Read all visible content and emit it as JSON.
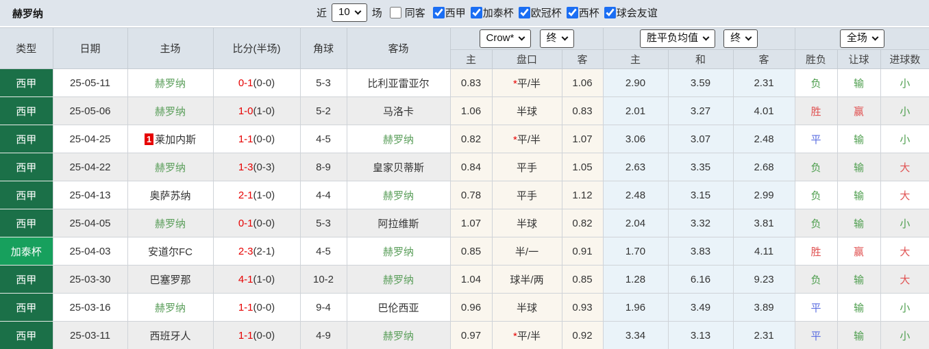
{
  "topbar": {
    "team_title": "赫罗纳",
    "recent_label": "近",
    "recent_count": "10",
    "matches_label": "场",
    "filters": [
      {
        "label": "同客",
        "checked": false
      },
      {
        "label": "西甲",
        "checked": true
      },
      {
        "label": "加泰杯",
        "checked": true
      },
      {
        "label": "欧冠杯",
        "checked": true
      },
      {
        "label": "西杯",
        "checked": true
      },
      {
        "label": "球会友谊",
        "checked": true
      }
    ]
  },
  "table": {
    "main_headers": [
      "类型",
      "日期",
      "主场",
      "比分(半场)",
      "角球",
      "客场"
    ],
    "selectors": {
      "odds_company": "Crow*",
      "odds_stage": "终",
      "avg_company": "胜平负均值",
      "avg_stage": "终",
      "scope": "全场"
    },
    "sub_headers": [
      "主",
      "盘口",
      "客",
      "主",
      "和",
      "客",
      "胜负",
      "让球",
      "进球数"
    ],
    "rows": [
      {
        "type": "西甲",
        "date": "25-05-11",
        "home": "赫罗纳",
        "home_badge": "",
        "score": "0-1",
        "half": "(0-0)",
        "corner": "5-3",
        "away": "比利亚雷亚尔",
        "odds_home": "0.83",
        "handicap_star": "*",
        "handicap": "平/半",
        "odds_away": "1.06",
        "avg_home": "2.90",
        "avg_draw": "3.59",
        "avg_away": "2.31",
        "result": "负",
        "handicap_result": "输",
        "goals": "小"
      },
      {
        "type": "西甲",
        "date": "25-05-06",
        "home": "赫罗纳",
        "home_badge": "",
        "score": "1-0",
        "half": "(1-0)",
        "corner": "5-2",
        "away": "马洛卡",
        "odds_home": "1.06",
        "handicap_star": "",
        "handicap": "半球",
        "odds_away": "0.83",
        "avg_home": "2.01",
        "avg_draw": "3.27",
        "avg_away": "4.01",
        "result": "胜",
        "handicap_result": "赢",
        "goals": "小"
      },
      {
        "type": "西甲",
        "date": "25-04-25",
        "home": "莱加内斯",
        "home_badge": "1",
        "score": "1-1",
        "half": "(0-0)",
        "corner": "4-5",
        "away": "赫罗纳",
        "odds_home": "0.82",
        "handicap_star": "*",
        "handicap": "平/半",
        "odds_away": "1.07",
        "avg_home": "3.06",
        "avg_draw": "3.07",
        "avg_away": "2.48",
        "result": "平",
        "handicap_result": "输",
        "goals": "小"
      },
      {
        "type": "西甲",
        "date": "25-04-22",
        "home": "赫罗纳",
        "home_badge": "",
        "score": "1-3",
        "half": "(0-3)",
        "corner": "8-9",
        "away": "皇家贝蒂斯",
        "odds_home": "0.84",
        "handicap_star": "",
        "handicap": "平手",
        "odds_away": "1.05",
        "avg_home": "2.63",
        "avg_draw": "3.35",
        "avg_away": "2.68",
        "result": "负",
        "handicap_result": "输",
        "goals": "大"
      },
      {
        "type": "西甲",
        "date": "25-04-13",
        "home": "奥萨苏纳",
        "home_badge": "",
        "score": "2-1",
        "half": "(1-0)",
        "corner": "4-4",
        "away": "赫罗纳",
        "odds_home": "0.78",
        "handicap_star": "",
        "handicap": "平手",
        "odds_away": "1.12",
        "avg_home": "2.48",
        "avg_draw": "3.15",
        "avg_away": "2.99",
        "result": "负",
        "handicap_result": "输",
        "goals": "大"
      },
      {
        "type": "西甲",
        "date": "25-04-05",
        "home": "赫罗纳",
        "home_badge": "",
        "score": "0-1",
        "half": "(0-0)",
        "corner": "5-3",
        "away": "阿拉维斯",
        "odds_home": "1.07",
        "handicap_star": "",
        "handicap": "半球",
        "odds_away": "0.82",
        "avg_home": "2.04",
        "avg_draw": "3.32",
        "avg_away": "3.81",
        "result": "负",
        "handicap_result": "输",
        "goals": "小"
      },
      {
        "type": "加泰杯",
        "date": "25-04-03",
        "home": "安道尔FC",
        "home_badge": "",
        "score": "2-3",
        "half": "(2-1)",
        "corner": "4-5",
        "away": "赫罗纳",
        "odds_home": "0.85",
        "handicap_star": "",
        "handicap": "半/一",
        "odds_away": "0.91",
        "avg_home": "1.70",
        "avg_draw": "3.83",
        "avg_away": "4.11",
        "result": "胜",
        "handicap_result": "赢",
        "goals": "大"
      },
      {
        "type": "西甲",
        "date": "25-03-30",
        "home": "巴塞罗那",
        "home_badge": "",
        "score": "4-1",
        "half": "(1-0)",
        "corner": "10-2",
        "away": "赫罗纳",
        "odds_home": "1.04",
        "handicap_star": "",
        "handicap": "球半/两",
        "odds_away": "0.85",
        "avg_home": "1.28",
        "avg_draw": "6.16",
        "avg_away": "9.23",
        "result": "负",
        "handicap_result": "输",
        "goals": "大"
      },
      {
        "type": "西甲",
        "date": "25-03-16",
        "home": "赫罗纳",
        "home_badge": "",
        "score": "1-1",
        "half": "(0-0)",
        "corner": "9-4",
        "away": "巴伦西亚",
        "odds_home": "0.96",
        "handicap_star": "",
        "handicap": "半球",
        "odds_away": "0.93",
        "avg_home": "1.96",
        "avg_draw": "3.49",
        "avg_away": "3.89",
        "result": "平",
        "handicap_result": "输",
        "goals": "小"
      },
      {
        "type": "西甲",
        "date": "25-03-11",
        "home": "西班牙人",
        "home_badge": "",
        "score": "1-1",
        "half": "(0-0)",
        "corner": "4-9",
        "away": "赫罗纳",
        "odds_home": "0.97",
        "handicap_star": "*",
        "handicap": "平/半",
        "odds_away": "0.92",
        "avg_home": "3.34",
        "avg_draw": "3.13",
        "avg_away": "2.31",
        "result": "平",
        "handicap_result": "输",
        "goals": "小"
      }
    ]
  },
  "colors": {
    "laliga_green": "#1b7048",
    "cup_green": "#17a05d",
    "team_green": "#5a9e5a",
    "score_red": "#e60000",
    "win_red": "#e05252",
    "draw_blue": "#5b6ee1",
    "lose_green": "#4e9e4e"
  }
}
